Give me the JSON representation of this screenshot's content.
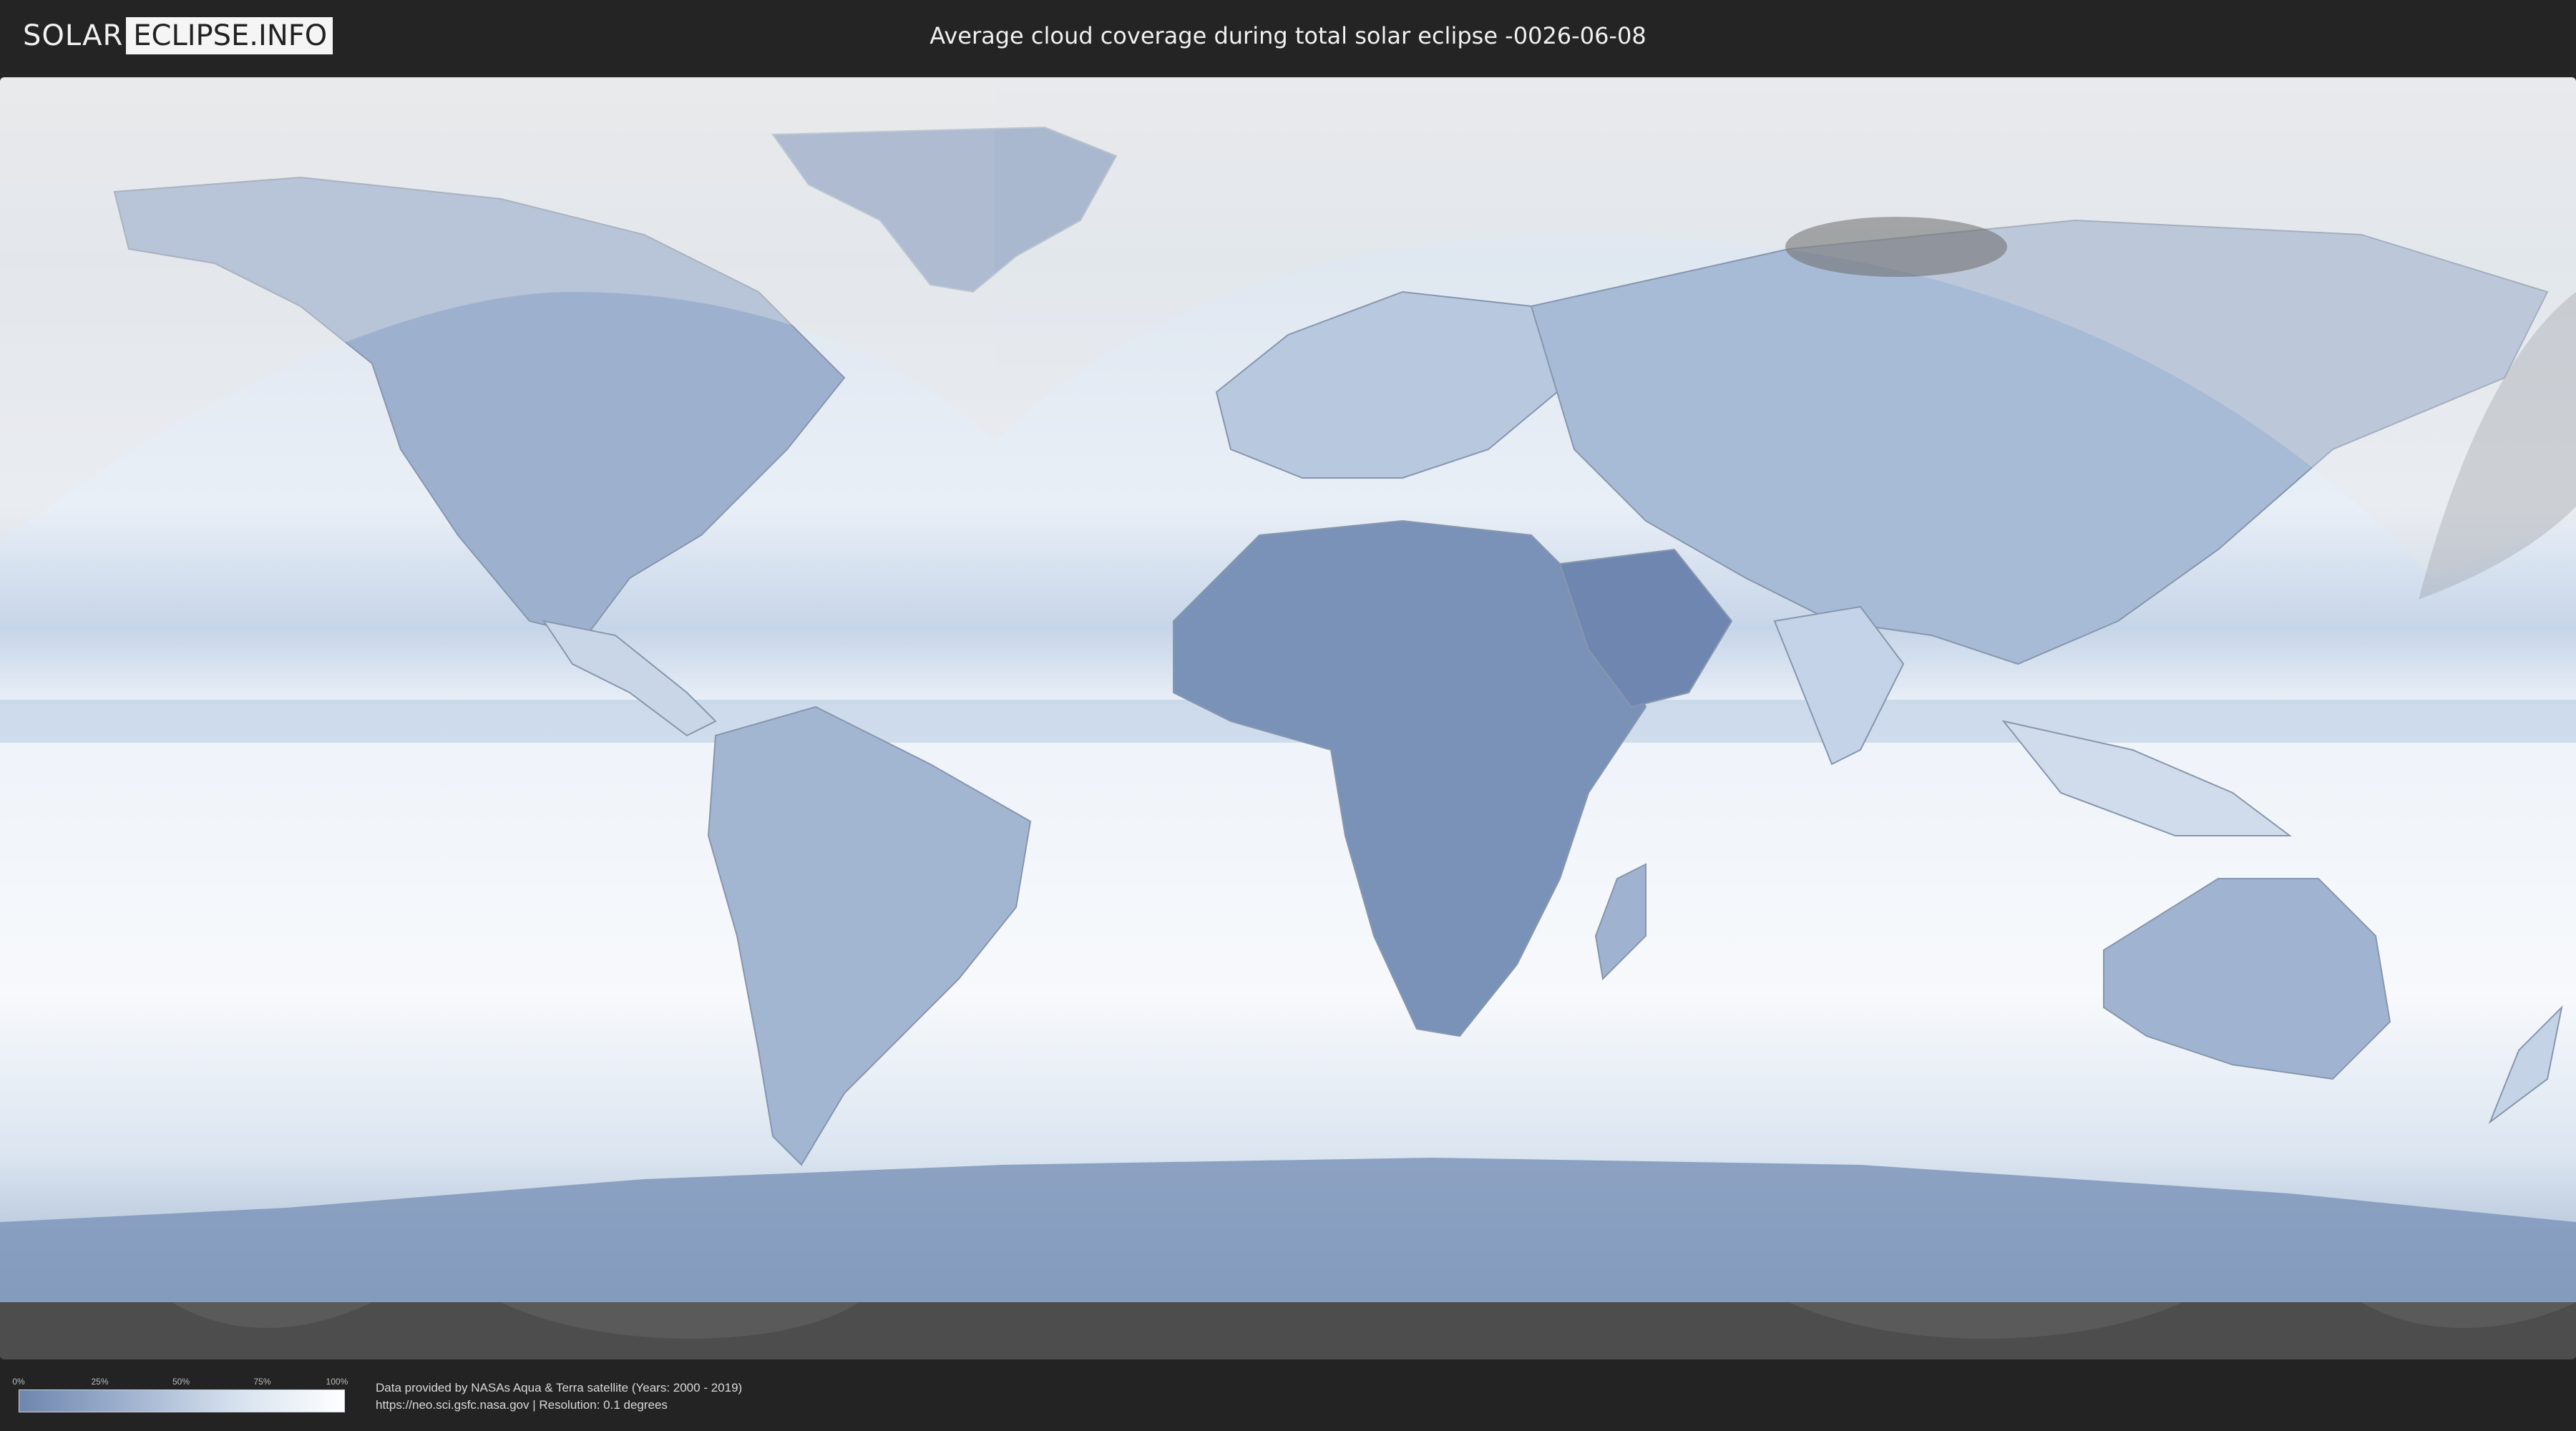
{
  "header": {
    "logo_part1": "SOLAR",
    "logo_part2": "ECLIPSE.INFO",
    "title": "Average cloud coverage during total solar eclipse -0026-06-08"
  },
  "map": {
    "subject": "world cloud coverage map",
    "colors": {
      "low_cloud": "#5f7aa5",
      "high_cloud": "#ffffff",
      "ocean_mid": "#c9d7ea",
      "night_shadow": "#4d4d4d"
    }
  },
  "legend": {
    "ticks": [
      "0%",
      "25%",
      "50%",
      "75%",
      "100%"
    ]
  },
  "credits": {
    "line1": "Data provided by NASAs Aqua & Terra satellite (Years: 2000 - 2019)",
    "line2": "https://neo.sci.gsfc.nasa.gov | Resolution: 0.1 degrees"
  }
}
